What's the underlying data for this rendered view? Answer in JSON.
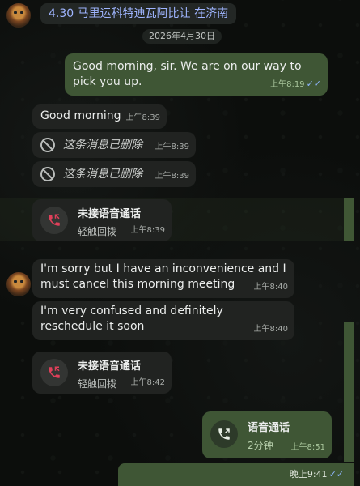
{
  "header": {
    "topic_title": "4.30 马里运科特迪瓦阿比让 在济南",
    "date_chip": "2026年4月30日"
  },
  "messages": [
    {
      "id": "m1",
      "dir": "out",
      "text": "Good morning, sir. We are on our way to pick you up.",
      "time": "上午8:19",
      "ticks": "✓✓"
    },
    {
      "id": "m2",
      "dir": "in",
      "text": "Good morning",
      "time": "上午8:39"
    },
    {
      "id": "m3",
      "dir": "in",
      "deleted": true,
      "text": "这条消息已删除",
      "time": "上午8:39"
    },
    {
      "id": "m4",
      "dir": "in",
      "deleted": true,
      "text": "这条消息已删除",
      "time": "上午8:39"
    },
    {
      "id": "m5",
      "dir": "in",
      "call": true,
      "title": "未接语音通话",
      "sub": "轻触回拨",
      "time": "上午8:39"
    },
    {
      "id": "m6",
      "dir": "in",
      "text": "I'm sorry but I have an inconvenience and I must cancel this morning meeting",
      "time": "上午8:40"
    },
    {
      "id": "m7",
      "dir": "in",
      "text": "I'm very confused and definitely reschedule it soon",
      "time": "上午8:40"
    },
    {
      "id": "m8",
      "dir": "in",
      "call": true,
      "title": "未接语音通话",
      "sub": "轻触回拨",
      "time": "上午8:42"
    },
    {
      "id": "m9",
      "dir": "out",
      "call": true,
      "title": "语音通话",
      "sub": "2分钟",
      "time": "上午8:51"
    }
  ],
  "footer": {
    "time": "晚上9:41",
    "ticks": "✓✓"
  },
  "colors": {
    "incoming": "#212321",
    "outgoing": "#3f5635",
    "link": "#9fb5ff",
    "missed": "#e0405a"
  }
}
